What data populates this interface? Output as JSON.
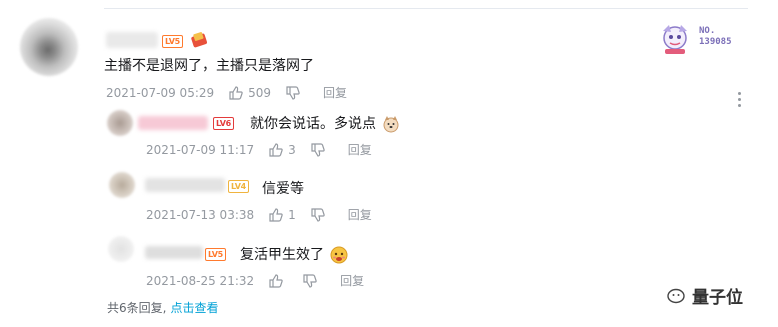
{
  "main_comment": {
    "level": "LV5",
    "text": "主播不是退网了，主播只是落网了",
    "time": "2021-07-09 05:29",
    "likes": "509",
    "reply_label": "回复"
  },
  "badge": {
    "number": "NO. 139085"
  },
  "replies": [
    {
      "level": "LV6",
      "text": "就你会说话。多说点",
      "time": "2021-07-09 11:17",
      "likes": "3",
      "reply_label": "回复"
    },
    {
      "level": "LV4",
      "text": "信爱等",
      "time": "2021-07-13 03:38",
      "likes": "1",
      "reply_label": "回复"
    },
    {
      "level": "LV5",
      "text": "复活甲生效了",
      "time": "2021-08-25 21:32",
      "likes": "",
      "reply_label": "回复"
    }
  ],
  "footer": {
    "count_text": "共6条回复,",
    "link_text": "点击查看"
  },
  "watermark": {
    "text": "量子位"
  },
  "colors": {
    "link": "#00a1d6",
    "meta": "#9499a0",
    "text": "#18191c"
  }
}
